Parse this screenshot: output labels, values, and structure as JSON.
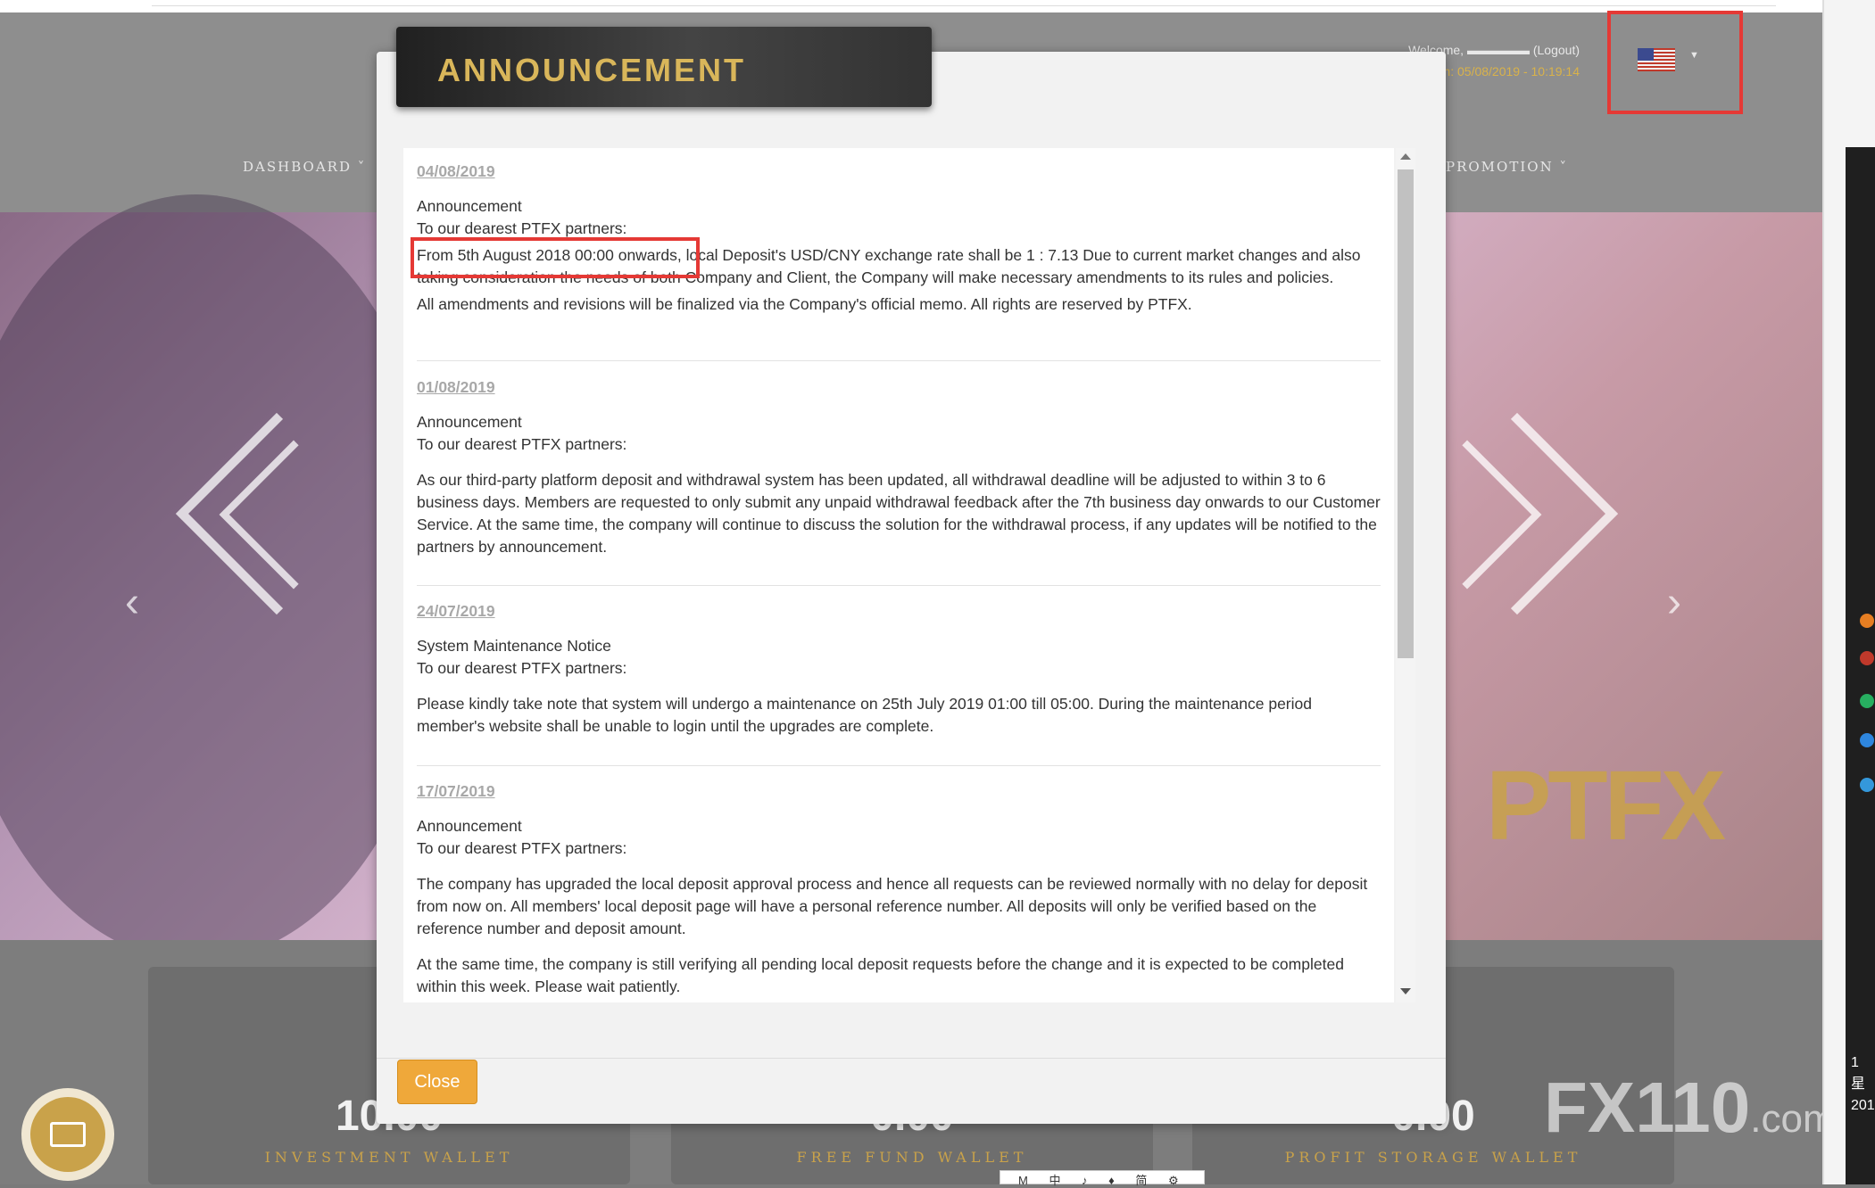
{
  "header": {
    "welcome_line": "Welcome, ▬▬▬▬▬ (Logout)",
    "last_login_line": "Last login: 05/08/2019 - 10:19:14",
    "nav_left": "DASHBOARD",
    "nav_right": "PROMOTION",
    "language_flag": "us-flag-icon"
  },
  "hero": {
    "brand_text": "PTFX"
  },
  "wallets": [
    {
      "value": "10.00",
      "label": "INVESTMENT WALLET"
    },
    {
      "value": "0.00",
      "label": "FREE FUND WALLET"
    },
    {
      "value": "0.00",
      "label": "PROFIT STORAGE WALLET"
    }
  ],
  "watermark": {
    "text": "FX110",
    "suffix": ".com"
  },
  "system": {
    "clock_line1": "1",
    "clock_line2": "星",
    "clock_line3": "201",
    "ime_text": "M 中 ♪ ♦ 简 ⚙"
  },
  "modal": {
    "title": "ANNOUNCEMENT",
    "close_label": "Close",
    "announcements": [
      {
        "date": "04/08/2019",
        "heading": "Announcement",
        "greeting": "To our dearest PTFX partners:",
        "paragraphs": [
          "From 5th August 2018 00:00 onwards, local Deposit's USD/CNY exchange rate shall be 1 : 7.13 Due to current market changes and also taking consideration the needs of both Company and Client, the Company will make necessary amendments to its rules and policies.",
          "All amendments and revisions will be finalized via the Company's official memo.  All rights are reserved by PTFX."
        ]
      },
      {
        "date": "01/08/2019",
        "heading": "Announcement",
        "greeting": "To our dearest PTFX partners:",
        "paragraphs": [
          "As our third-party platform deposit and withdrawal system has been updated, all withdrawal deadline will be adjusted to within 3 to 6 business days. Members are requested to only submit any unpaid withdrawal feedback after the 7th business day onwards to our Customer Service. At the same time, the company will continue to discuss the solution for the withdrawal process, if any updates will be notified to the partners by announcement."
        ]
      },
      {
        "date": "24/07/2019",
        "heading": "System Maintenance Notice",
        "greeting": "To our dearest PTFX partners:",
        "paragraphs": [
          "Please kindly take note that system will undergo a maintenance on 25th July 2019 01:00 till 05:00. During the maintenance period member's website shall be unable to login until the upgrades are complete."
        ]
      },
      {
        "date": "17/07/2019",
        "heading": "Announcement",
        "greeting": "To our dearest PTFX partners:",
        "paragraphs": [
          "The company has upgraded the local deposit approval process  and hence all requests can be reviewed normally with no delay for deposit from now on. All members' local deposit page will have a personal reference number. All deposits will only be verified based on the reference number and deposit amount.",
          "At the same time, the company is still verifying  all pending local deposit requests before the change and it is expected to be completed within this week. Please wait patiently."
        ]
      }
    ]
  }
}
